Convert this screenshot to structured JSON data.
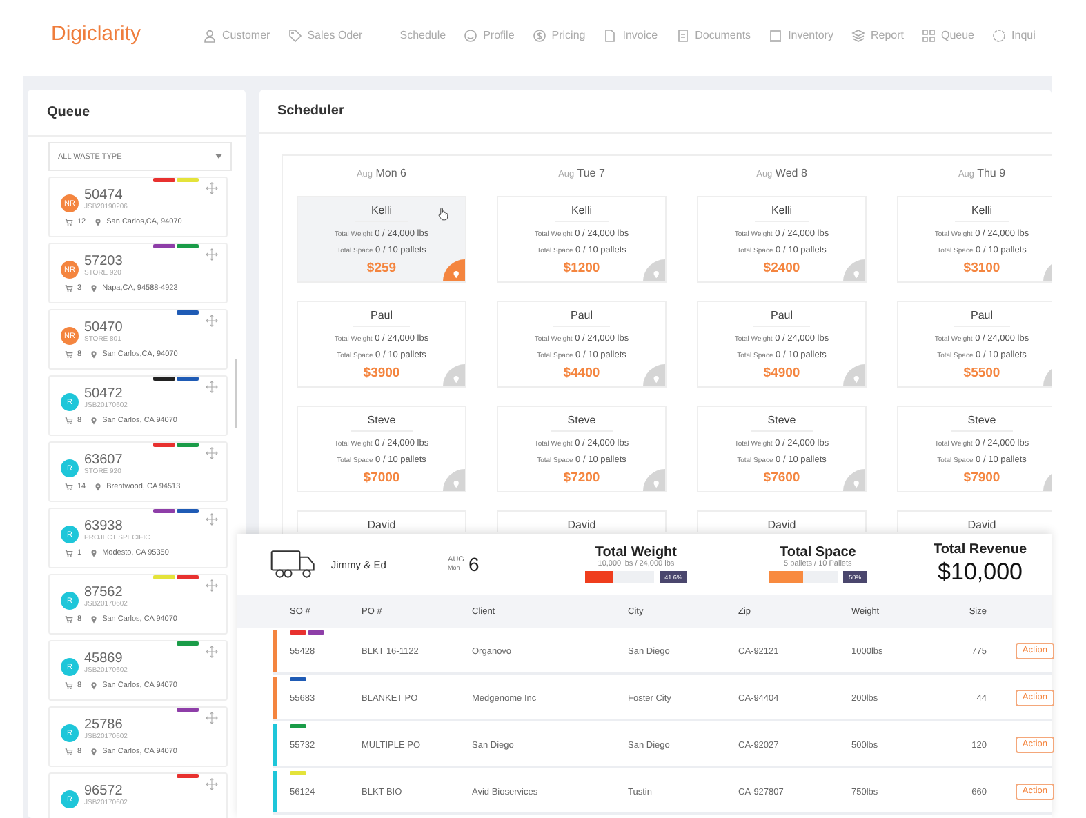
{
  "brand": "Digiclarity",
  "nav": [
    {
      "label": "Customer"
    },
    {
      "label": "Sales Oder"
    },
    {
      "label": "Schedule"
    },
    {
      "label": "Profile"
    },
    {
      "label": "Pricing"
    },
    {
      "label": "Invoice"
    },
    {
      "label": "Documents"
    },
    {
      "label": "Inventory"
    },
    {
      "label": "Report"
    },
    {
      "label": "Queue"
    },
    {
      "label": "Inqui"
    }
  ],
  "queue": {
    "title": "Queue",
    "filter": "ALL WASTE TYPE",
    "items": [
      {
        "badge": "NR",
        "color": "#f4853f",
        "number": "50474",
        "ref": "JSB20190206",
        "count": "12",
        "location": "San Carlos,CA, 94070",
        "tags": [
          {
            "color": "#e8312f"
          },
          {
            "color": "#e4e33a"
          }
        ]
      },
      {
        "badge": "NR",
        "color": "#f4853f",
        "number": "57203",
        "ref": "STORE 920",
        "count": "3",
        "location": "Napa,CA, 94588-4923",
        "tags": [
          {
            "color": "#8e3ea8"
          },
          {
            "color": "#1a9c48"
          }
        ]
      },
      {
        "badge": "NR",
        "color": "#f4853f",
        "number": "50470",
        "ref": "STORE 801",
        "count": "8",
        "location": "San Carlos,CA, 94070",
        "tags": [
          {
            "color": "#1f5bb5"
          }
        ]
      },
      {
        "badge": "R",
        "color": "#1ec6d9",
        "number": "50472",
        "ref": "JSB20170602",
        "count": "8",
        "location": "San Carlos, CA 94070",
        "tags": [
          {
            "color": "#222222"
          },
          {
            "color": "#1f5bb5"
          }
        ]
      },
      {
        "badge": "R",
        "color": "#1ec6d9",
        "number": "63607",
        "ref": "STORE 920",
        "count": "14",
        "location": "Brentwood, CA 94513",
        "tags": [
          {
            "color": "#e8312f"
          },
          {
            "color": "#1a9c48"
          }
        ]
      },
      {
        "badge": "R",
        "color": "#1ec6d9",
        "number": "63938",
        "ref": "PROJECT SPECIFIC",
        "count": "1",
        "location": "Modesto, CA 95350",
        "tags": [
          {
            "color": "#8e3ea8"
          },
          {
            "color": "#1f5bb5"
          }
        ]
      },
      {
        "badge": "R",
        "color": "#1ec6d9",
        "number": "87562",
        "ref": "JSB20170602",
        "count": "8",
        "location": "San Carlos, CA 94070",
        "tags": [
          {
            "color": "#e4e33a"
          },
          {
            "color": "#e8312f"
          }
        ]
      },
      {
        "badge": "R",
        "color": "#1ec6d9",
        "number": "45869",
        "ref": "JSB20170602",
        "count": "8",
        "location": "San Carlos, CA 94070",
        "tags": [
          {
            "color": "#1a9c48"
          }
        ]
      },
      {
        "badge": "R",
        "color": "#1ec6d9",
        "number": "25786",
        "ref": "JSB20170602",
        "count": "8",
        "location": "San Carlos, CA 94070",
        "tags": [
          {
            "color": "#8e3ea8"
          }
        ]
      },
      {
        "badge": "R",
        "color": "#1ec6d9",
        "number": "96572",
        "ref": "JSB20170602",
        "tags": [
          {
            "color": "#e8312f"
          }
        ]
      }
    ]
  },
  "scheduler": {
    "title": "Scheduler",
    "days": [
      {
        "month": "Aug",
        "day": "Mon 6",
        "cards": [
          {
            "name": "Kelli",
            "weight_label": "Total Weight",
            "weight": "0 / 24,000 lbs",
            "space_label": "Total Space",
            "space": "0 / 10 pallets",
            "price": "$259",
            "selected": true,
            "hovered": true
          },
          {
            "name": "Paul",
            "weight_label": "Total Weight",
            "weight": "0 / 24,000 lbs",
            "space_label": "Total Space",
            "space": "0 / 10 pallets",
            "price": "$3900",
            "selected": false,
            "hovered": false
          },
          {
            "name": "Steve",
            "weight_label": "Total Weight",
            "weight": "0 / 24,000 lbs",
            "space_label": "Total Space",
            "space": "0 / 10 pallets",
            "price": "$7000",
            "selected": false,
            "hovered": false
          },
          {
            "name": "David",
            "selected": false,
            "hovered": false
          }
        ]
      },
      {
        "month": "Aug",
        "day": "Tue 7",
        "cards": [
          {
            "name": "Kelli",
            "weight_label": "Total Weight",
            "weight": "0 / 24,000 lbs",
            "space_label": "Total Space",
            "space": "0 / 10 pallets",
            "price": "$1200",
            "selected": false,
            "hovered": false
          },
          {
            "name": "Paul",
            "weight_label": "Total Weight",
            "weight": "0 / 24,000 lbs",
            "space_label": "Total Space",
            "space": "0 / 10 pallets",
            "price": "$4400",
            "selected": false,
            "hovered": false
          },
          {
            "name": "Steve",
            "weight_label": "Total Weight",
            "weight": "0 / 24,000 lbs",
            "space_label": "Total Space",
            "space": "0 / 10 pallets",
            "price": "$7200",
            "selected": false,
            "hovered": false
          },
          {
            "name": "David",
            "selected": false,
            "hovered": false
          }
        ]
      },
      {
        "month": "Aug",
        "day": "Wed 8",
        "cards": [
          {
            "name": "Kelli",
            "weight_label": "Total Weight",
            "weight": "0 / 24,000 lbs",
            "space_label": "Total Space",
            "space": "0 / 10 pallets",
            "price": "$2400",
            "selected": false,
            "hovered": false
          },
          {
            "name": "Paul",
            "weight_label": "Total Weight",
            "weight": "0 / 24,000 lbs",
            "space_label": "Total Space",
            "space": "0 / 10 pallets",
            "price": "$4900",
            "selected": false,
            "hovered": false
          },
          {
            "name": "Steve",
            "weight_label": "Total Weight",
            "weight": "0 / 24,000 lbs",
            "space_label": "Total Space",
            "space": "0 / 10 pallets",
            "price": "$7600",
            "selected": false,
            "hovered": false
          },
          {
            "name": "David",
            "selected": false,
            "hovered": false
          }
        ]
      },
      {
        "month": "Aug",
        "day": "Thu 9",
        "cards": [
          {
            "name": "Kelli",
            "weight_label": "Total Weight",
            "weight": "0 / 24,000 lbs",
            "space_label": "Total Space",
            "space": "0 / 10 pallets",
            "price": "$3100",
            "selected": false,
            "hovered": false
          },
          {
            "name": "Paul",
            "weight_label": "Total Weight",
            "weight": "0 / 24,000 lbs",
            "space_label": "Total Space",
            "space": "0 / 10 pallets",
            "price": "$5500",
            "selected": false,
            "hovered": false
          },
          {
            "name": "Steve",
            "weight_label": "Total Weight",
            "weight": "0 / 24,000 lbs",
            "space_label": "Total Space",
            "space": "0 / 10 pallets",
            "price": "$7900",
            "selected": false,
            "hovered": false
          },
          {
            "name": "David",
            "selected": false,
            "hovered": false
          }
        ]
      }
    ]
  },
  "trip": {
    "crew": "Jimmy & Ed",
    "month": "AUG",
    "weekday": "Mon",
    "date": "6",
    "weight": {
      "title": "Total Weight",
      "reading": "10,000 lbs / 24,000 lbs",
      "level": 0.416,
      "percent": "41.6%"
    },
    "space": {
      "title": "Total Space",
      "reading": "5 pallets / 10 Pallets",
      "level": 0.5,
      "percent": "50%"
    },
    "revenue": {
      "title": "Total Revenue",
      "value": "$10,000"
    },
    "columns": [
      "SO #",
      "PO #",
      "Client",
      "City",
      "Zip",
      "Weight",
      "Size"
    ],
    "rows": [
      {
        "color": "#f4853f",
        "tags": [
          {
            "color": "#e8312f"
          },
          {
            "color": "#8e3ea8"
          }
        ],
        "cells": [
          "55428",
          "BLKT 16-1122",
          "Organovo",
          "San Diego",
          "CA-92121",
          "1000lbs",
          "775"
        ],
        "action": "Action"
      },
      {
        "color": "#f4853f",
        "tags": [
          {
            "color": "#1f5bb5"
          }
        ],
        "cells": [
          "55683",
          "BLANKET PO",
          "Medgenome Inc",
          "Foster City",
          "CA-94404",
          "200lbs",
          "44"
        ],
        "action": "Action"
      },
      {
        "color": "#1ec6d9",
        "tags": [
          {
            "color": "#1a9c48"
          }
        ],
        "cells": [
          "55732",
          "MULTIPLE PO",
          "San Diego",
          "San Diego",
          "CA-92027",
          "500lbs",
          "120"
        ],
        "action": "Action"
      },
      {
        "color": "#1ec6d9",
        "tags": [
          {
            "color": "#e4e33a"
          }
        ],
        "cells": [
          "56124",
          "BLKT BIO",
          "Avid Bioservices",
          "Tustin",
          "CA-927807",
          "750lbs",
          "660"
        ],
        "action": "Action"
      }
    ]
  }
}
